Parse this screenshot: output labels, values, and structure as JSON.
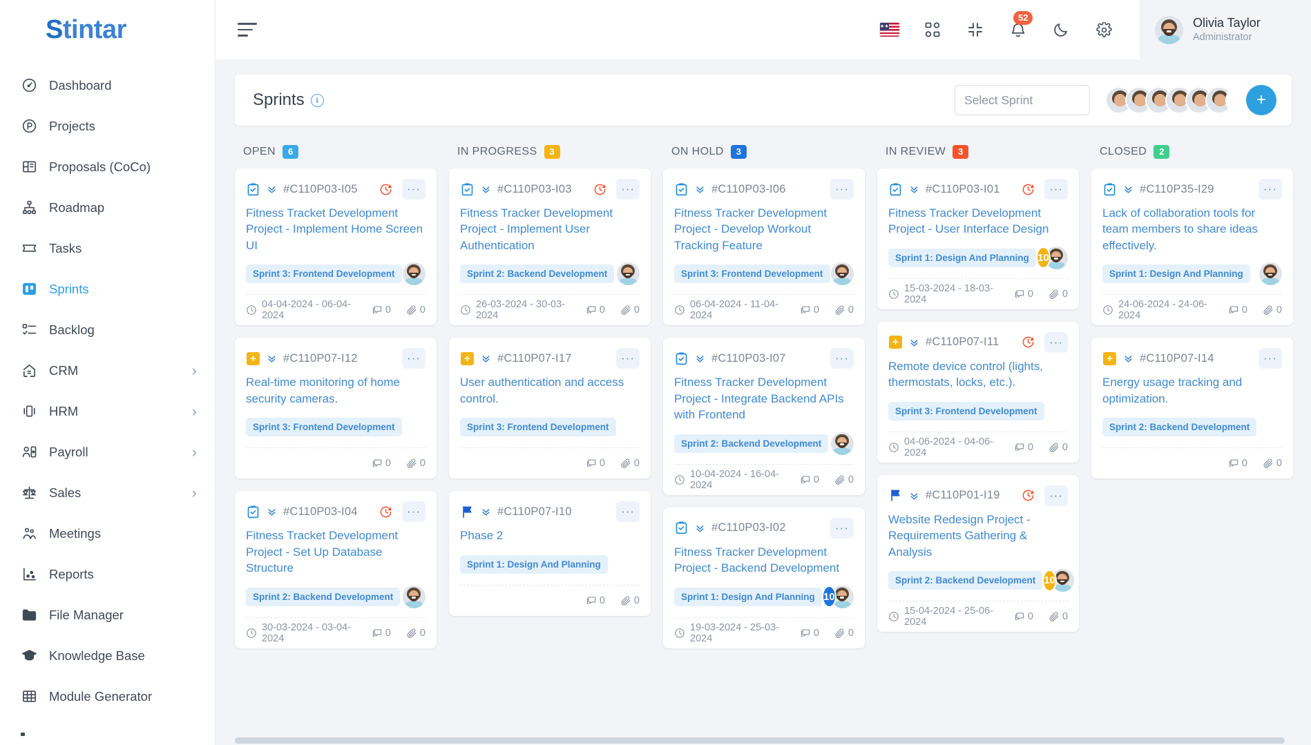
{
  "brand": {
    "name": "Stintar",
    "accent": "#2aa0e8"
  },
  "sidebar": {
    "items": [
      {
        "label": "Dashboard",
        "icon": "gauge-icon",
        "active": false,
        "expandable": false
      },
      {
        "label": "Projects",
        "icon": "projects-icon",
        "active": false,
        "expandable": false
      },
      {
        "label": "Proposals (CoCo)",
        "icon": "proposals-icon",
        "active": false,
        "expandable": false
      },
      {
        "label": "Roadmap",
        "icon": "roadmap-icon",
        "active": false,
        "expandable": false
      },
      {
        "label": "Tasks",
        "icon": "tasks-icon",
        "active": false,
        "expandable": false
      },
      {
        "label": "Sprints",
        "icon": "sprints-icon",
        "active": true,
        "expandable": false
      },
      {
        "label": "Backlog",
        "icon": "backlog-icon",
        "active": false,
        "expandable": false
      },
      {
        "label": "CRM",
        "icon": "crm-icon",
        "active": false,
        "expandable": true
      },
      {
        "label": "HRM",
        "icon": "hrm-icon",
        "active": false,
        "expandable": true
      },
      {
        "label": "Payroll",
        "icon": "payroll-icon",
        "active": false,
        "expandable": true
      },
      {
        "label": "Sales",
        "icon": "sales-icon",
        "active": false,
        "expandable": true
      },
      {
        "label": "Meetings",
        "icon": "meetings-icon",
        "active": false,
        "expandable": false
      },
      {
        "label": "Reports",
        "icon": "reports-icon",
        "active": false,
        "expandable": false
      },
      {
        "label": "File Manager",
        "icon": "folder-icon",
        "active": false,
        "expandable": false
      },
      {
        "label": "Knowledge Base",
        "icon": "graduation-cap-icon",
        "active": false,
        "expandable": false
      },
      {
        "label": "Module Generator",
        "icon": "grid-icon",
        "active": false,
        "expandable": false
      }
    ]
  },
  "topbar": {
    "menu_icon": "hamburger-icon",
    "language_flag": "us-flag-icon",
    "apps_icon": "apps-grid-icon",
    "fullscreen_icon": "collapse-screen-icon",
    "notifications_icon": "bell-icon",
    "notifications_count": "52",
    "theme_icon": "moon-icon",
    "settings_icon": "gear-icon",
    "user": {
      "name": "Olivia Taylor",
      "role": "Administrator",
      "avatar": "user-avatar"
    }
  },
  "sprint_bar": {
    "title": "Sprints",
    "info_icon": "info-icon",
    "select_placeholder": "Select Sprint",
    "members": 6,
    "ghost_member": true,
    "add_label": "+"
  },
  "board": {
    "columns": [
      {
        "name": "OPEN",
        "count": "6",
        "color": "#39a9e8",
        "cards": [
          {
            "type_icon": "clipboard-check-icon",
            "priority_icon": "chevrons-down-icon",
            "id": "#C110P03-I05",
            "overdue": true,
            "menu": "···",
            "title": "Fitness Tracket Development Project - Implement Home Screen UI",
            "sprint": "Sprint 3: Frontend Development",
            "badge": null,
            "avatar": "photo",
            "dates": "04-04-2024 - 06-04-2024",
            "comments": "0",
            "attachments": "0"
          },
          {
            "type_icon": "plus-square-icon",
            "priority_icon": "chevrons-down-icon",
            "id": "#C110P07-I12",
            "overdue": false,
            "menu": "···",
            "title": "Real-time monitoring of home security cameras.",
            "sprint": "Sprint 3: Frontend Development",
            "badge": null,
            "avatar": "none",
            "dates": "",
            "comments": "0",
            "attachments": "0"
          },
          {
            "type_icon": "clipboard-check-icon",
            "priority_icon": "chevrons-down-icon",
            "id": "#C110P03-I04",
            "overdue": true,
            "menu": "···",
            "title": "Fitness Tracket Development Project - Set Up Database Structure",
            "sprint": "Sprint 2: Backend Development",
            "badge": null,
            "avatar": "photo",
            "dates": "30-03-2024 - 03-04-2024",
            "comments": "0",
            "attachments": "0"
          }
        ]
      },
      {
        "name": "IN PROGRESS",
        "count": "3",
        "color": "#f5b416",
        "cards": [
          {
            "type_icon": "clipboard-check-icon",
            "priority_icon": "chevrons-down-icon",
            "id": "#C110P03-I03",
            "overdue": true,
            "menu": "···",
            "title": "Fitness Tracker Development Project - Implement User Authentication",
            "sprint": "Sprint 2: Backend Development",
            "badge": null,
            "avatar": "photo",
            "dates": "26-03-2024 - 30-03-2024",
            "comments": "0",
            "attachments": "0"
          },
          {
            "type_icon": "plus-square-icon",
            "priority_icon": "chevrons-down-icon",
            "id": "#C110P07-I17",
            "overdue": false,
            "menu": "···",
            "title": "User authentication and access control.",
            "sprint": "Sprint 3: Frontend Development",
            "badge": null,
            "avatar": "none",
            "dates": "",
            "comments": "0",
            "attachments": "0"
          },
          {
            "type_icon": "flag-icon",
            "priority_icon": "chevrons-down-icon",
            "id": "#C110P07-I10",
            "overdue": false,
            "menu": "···",
            "title": "Phase 2",
            "sprint": "Sprint 1: Design And Planning",
            "badge": null,
            "avatar": "none",
            "dates": "",
            "comments": "0",
            "attachments": "0"
          }
        ]
      },
      {
        "name": "ON HOLD",
        "count": "3",
        "color": "#1e74dd",
        "cards": [
          {
            "type_icon": "clipboard-check-icon",
            "priority_icon": "chevrons-down-icon",
            "id": "#C110P03-I06",
            "overdue": false,
            "menu": "···",
            "title": "Fitness Tracker Development Project - Develop Workout Tracking Feature",
            "sprint": "Sprint 3: Frontend Development",
            "badge": null,
            "avatar": "photo",
            "dates": "06-04-2024 - 11-04-2024",
            "comments": "0",
            "attachments": "0"
          },
          {
            "type_icon": "clipboard-check-icon",
            "priority_icon": "chevrons-down-icon",
            "id": "#C110P03-I07",
            "overdue": false,
            "menu": "···",
            "title": "Fitness Tracker Development Project - Integrate Backend APIs with Frontend",
            "sprint": "Sprint 2: Backend Development",
            "badge": null,
            "avatar": "photo",
            "dates": "10-04-2024 - 16-04-2024",
            "comments": "0",
            "attachments": "0"
          },
          {
            "type_icon": "clipboard-check-icon",
            "priority_icon": "chevrons-down-icon",
            "id": "#C110P03-I02",
            "overdue": false,
            "menu": "···",
            "title": "Fitness Tracker Development Project - Backend Development",
            "sprint": "Sprint 1: Design And Planning",
            "badge": "10",
            "badge_color": "blue",
            "avatar": "photo",
            "dates": "19-03-2024 - 25-03-2024",
            "comments": "0",
            "attachments": "0"
          }
        ]
      },
      {
        "name": "IN REVIEW",
        "count": "3",
        "color": "#f4542c",
        "cards": [
          {
            "type_icon": "clipboard-check-icon",
            "priority_icon": "chevrons-down-icon",
            "id": "#C110P03-I01",
            "overdue": true,
            "menu": "···",
            "title": "Fitness Tracker Development Project - User Interface Design",
            "sprint": "Sprint 1: Design And Planning",
            "badge": "10",
            "badge_color": "amber",
            "avatar": "photo",
            "dates": "15-03-2024 - 18-03-2024",
            "comments": "0",
            "attachments": "0"
          },
          {
            "type_icon": "plus-square-icon",
            "priority_icon": "chevrons-down-icon",
            "id": "#C110P07-I11",
            "overdue": true,
            "menu": "···",
            "title": "Remote device control (lights, thermostats, locks, etc.).",
            "sprint": "Sprint 3: Frontend Development",
            "badge": null,
            "avatar": "none",
            "dates": "04-06-2024 - 04-06-2024",
            "comments": "0",
            "attachments": "0"
          },
          {
            "type_icon": "flag-icon",
            "priority_icon": "chevrons-down-icon",
            "id": "#C110P01-I19",
            "overdue": true,
            "menu": "···",
            "title": "Website Redesign Project - Requirements Gathering & Analysis",
            "sprint": "Sprint 2: Backend Development",
            "badge": "10",
            "badge_color": "amber",
            "avatar": "photo",
            "dates": "15-04-2024 - 25-06-2024",
            "comments": "0",
            "attachments": "0"
          }
        ]
      },
      {
        "name": "CLOSED",
        "count": "2",
        "color": "#3ecf8e",
        "cards": [
          {
            "type_icon": "clipboard-check-icon",
            "priority_icon": "chevrons-down-icon",
            "id": "#C110P35-I29",
            "overdue": false,
            "menu": "···",
            "title": "Lack of collaboration tools for team members to share ideas effectively.",
            "sprint": "Sprint 1: Design And Planning",
            "badge": null,
            "avatar": "photo",
            "dates": "24-06-2024 - 24-06-2024",
            "comments": "0",
            "attachments": "0"
          },
          {
            "type_icon": "plus-square-icon",
            "priority_icon": "chevrons-down-icon",
            "id": "#C110P07-I14",
            "overdue": false,
            "menu": "···",
            "title": "Energy usage tracking and optimization.",
            "sprint": "Sprint 2: Backend Development",
            "badge": null,
            "avatar": "none",
            "dates": "",
            "comments": "0",
            "attachments": "0"
          }
        ]
      }
    ]
  }
}
